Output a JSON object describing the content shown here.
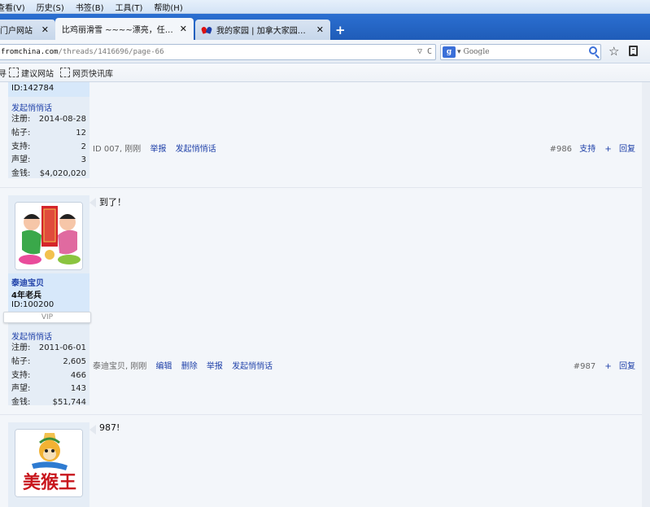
{
  "menubar": {
    "items": [
      "查看(V)",
      "历史(S)",
      "书签(B)",
      "工具(T)",
      "帮助(H)"
    ]
  },
  "tabs": [
    {
      "label": "门户网站",
      "close": "✕",
      "state": "inactive"
    },
    {
      "label": "比鸡丽滑雪 ~~~~漂亮，任性…",
      "close": "✕",
      "state": "active"
    },
    {
      "label": "我的家园 | 加拿大家园论坛",
      "close": "✕",
      "state": "inactive"
    }
  ],
  "newtab_label": "+",
  "navbar": {
    "url_dark": "fromchina.com",
    "url_light": "/threads/1416696/page-66",
    "search_engine_badge": "g",
    "search_placeholder": "Google",
    "url_icons": "▽ C"
  },
  "bookmarks": [
    {
      "label": "建议网站"
    },
    {
      "label": "网页快讯库"
    }
  ],
  "bookmarks_prefix": "寻",
  "posts": [
    {
      "id_text": "ID:142784",
      "start_chat": "发起悄悄话",
      "stats": [
        {
          "k": "注册:",
          "v": "2014-08-28"
        },
        {
          "k": "帖子:",
          "v": "12"
        },
        {
          "k": "支持:",
          "v": "2"
        },
        {
          "k": "声望:",
          "v": "3"
        },
        {
          "k": "金钱:",
          "v": "$4,020,020"
        }
      ],
      "meta_author": "ID 007, 刚刚",
      "meta_actions": [
        "举报",
        "发起悄悄话"
      ],
      "post_no": "#986",
      "right_actions": [
        "支持"
      ],
      "plus": "+",
      "reply": "回复"
    },
    {
      "username": "泰迪宝贝",
      "rank": "4年老兵",
      "id_text": "ID:100200",
      "vip": "VIP",
      "start_chat": "发起悄悄话",
      "body": "到了！",
      "stats": [
        {
          "k": "注册:",
          "v": "2011-06-01"
        },
        {
          "k": "帖子:",
          "v": "2,605"
        },
        {
          "k": "支持:",
          "v": "466"
        },
        {
          "k": "声望:",
          "v": "143"
        },
        {
          "k": "金钱:",
          "v": "$51,744"
        }
      ],
      "meta_author": "泰迪宝贝, 刚刚",
      "meta_actions": [
        "编辑",
        "删除",
        "举报",
        "发起悄悄话"
      ],
      "post_no": "#987",
      "plus": "+",
      "reply": "回复"
    },
    {
      "body": "987!",
      "avatar_text": "美猴王"
    }
  ],
  "colors": {
    "link": "#1d3fa8",
    "tab_bar": "#2b6fd1",
    "page_bg": "#f3f6fa"
  }
}
